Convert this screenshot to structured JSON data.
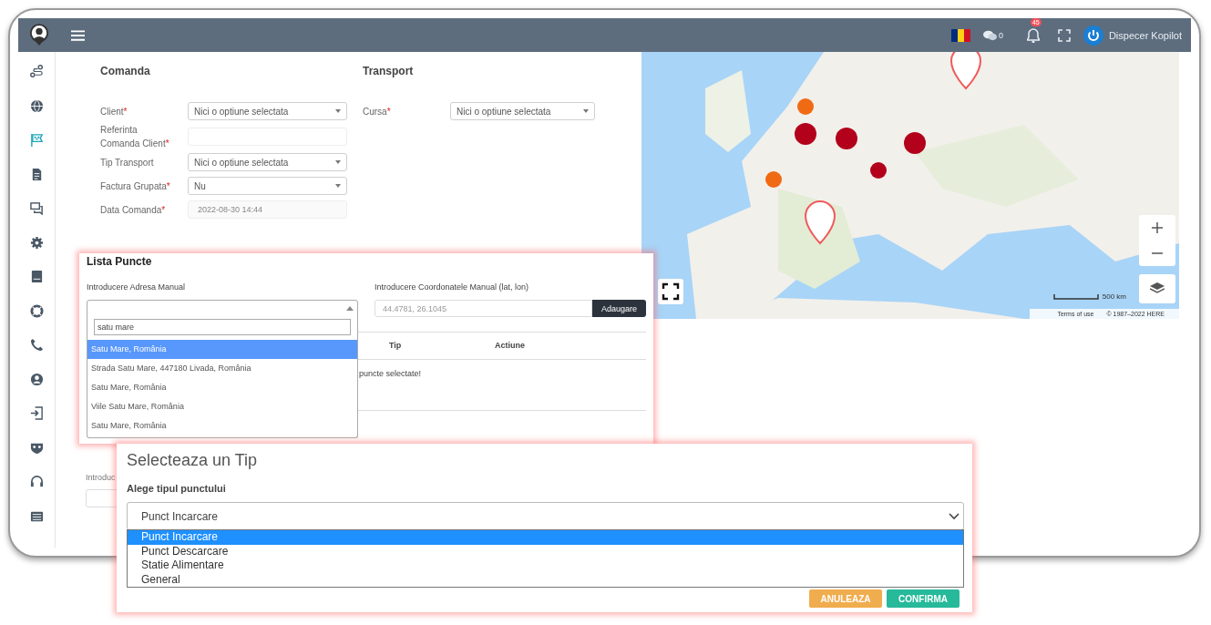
{
  "topbar": {
    "messages_count": "0",
    "notifications_count": "45",
    "user": "Dispecer Kopilot"
  },
  "sidebar": {
    "items": [
      {
        "selected": false
      },
      {
        "selected": false
      },
      {
        "selected": true
      },
      {
        "selected": false
      },
      {
        "selected": false
      },
      {
        "selected": false
      },
      {
        "selected": false
      },
      {
        "selected": false
      },
      {
        "selected": false
      },
      {
        "selected": false
      },
      {
        "selected": false
      },
      {
        "selected": false
      },
      {
        "selected": false
      },
      {
        "selected": false
      }
    ]
  },
  "comanda": {
    "title": "Comanda",
    "fields": [
      {
        "label": "Client",
        "required_mark": "*",
        "kind": "select",
        "value": "Nici o optiune selectata"
      },
      {
        "label": "Referinta Comanda Client",
        "required_mark": "*",
        "kind": "text"
      },
      {
        "label": "Tip Transport",
        "kind": "select",
        "value": "Nici o optiune selectata"
      },
      {
        "label": "Factura Grupata",
        "required_mark": "*",
        "kind": "select",
        "value": "Nu"
      },
      {
        "label": "Data Comanda",
        "required_mark": "*",
        "kind": "date",
        "value": "2022-08-30 14:44"
      }
    ]
  },
  "transport": {
    "title": "Transport",
    "fields": [
      {
        "label": "Cursa",
        "required_mark": "*",
        "kind": "select",
        "value": "Nici o optiune selectata"
      }
    ]
  },
  "map": {
    "scale": "500 km",
    "terms": "Terms of use",
    "copyright": "© 1987–2022 HERE"
  },
  "background_field": {
    "label": "Introduc"
  },
  "lista_puncte": {
    "title": "Lista Puncte",
    "address_label": "Introducere Adresa Manual",
    "address_search": "satu mare",
    "address_options": [
      {
        "label": "Satu Mare, România",
        "selected": true
      },
      {
        "label": "Strada Satu Mare, 447180 Livada, România",
        "selected": false
      },
      {
        "label": "Satu Mare, România",
        "selected": false
      },
      {
        "label": "Viile Satu Mare, România",
        "selected": false
      },
      {
        "label": "Satu Mare, România",
        "selected": false
      }
    ],
    "coords_label": "Introducere Coordonatele Manual (lat, lon)",
    "coords_placeholder": "44.4781, 26.1045",
    "add_button": "Adaugare",
    "columns": [
      "Tip",
      "Actiune"
    ],
    "empty_message": "puncte selectate!"
  },
  "modal": {
    "title": "Selecteaza un Tip",
    "label": "Alege tipul punctului",
    "value": "Punct Incarcare",
    "options": [
      {
        "label": "Punct Incarcare",
        "selected": true
      },
      {
        "label": "Punct Descarcare",
        "selected": false
      },
      {
        "label": "Statie Alimentare",
        "selected": false
      },
      {
        "label": "General",
        "selected": false
      }
    ],
    "buttons": [
      {
        "label": "ANULEAZA",
        "kind": "cancel"
      },
      {
        "label": "CONFIRMA",
        "kind": "confirm"
      }
    ]
  }
}
